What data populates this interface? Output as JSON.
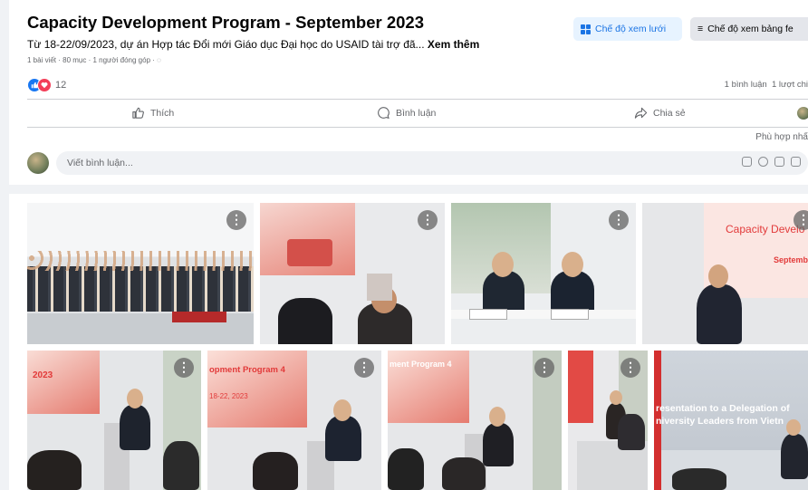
{
  "post": {
    "title": "Capacity Development Program - September 2023",
    "description": "Từ 18-22/09/2023, dự án Hợp tác Đổi mới Giáo dục Đại học do USAID tài trợ đã...",
    "see_more": "Xem thêm",
    "meta": "1 bài viết · 80 mục · 1 người đóng góp · ",
    "reaction_count": "12",
    "comments_stat": "1 bình luận",
    "shares_stat": "1 lượt chi"
  },
  "view_buttons": {
    "grid": "Chế độ xem lưới",
    "feed": "Chế độ xem bảng fe"
  },
  "actions": {
    "like": "Thích",
    "comment": "Bình luận",
    "share": "Chia sẻ"
  },
  "relevance": "Phù hợp nhấ",
  "comment_placeholder": "Viết bình luận...",
  "slide_text": {
    "p4_title": "Capacity Develo",
    "p4_sub": "Septemb",
    "p5_banner": "2023",
    "p6_banner": "opment Program 4",
    "p6_sub": "18-22, 2023",
    "p7_banner": "ment Program 4",
    "p9_line1": "resentation to a Delegation of",
    "p9_line2": "niversity Leaders from Vietn"
  },
  "colors": {
    "accent": "#1b74e4",
    "like": "#1877f2",
    "love": "#f33e58",
    "page_bg": "#f0f2f5",
    "slide_red": "#e23a3a"
  },
  "icons": [
    "grid-icon",
    "menu-icon",
    "like-icon",
    "love-icon",
    "thumbs-up-icon",
    "comment-icon",
    "share-icon",
    "more-icon"
  ]
}
